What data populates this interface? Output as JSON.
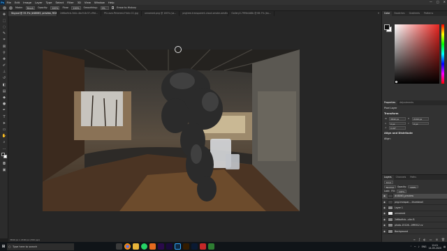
{
  "menubar": {
    "app_badge": "Ps",
    "items": [
      "File",
      "Edit",
      "Image",
      "Layer",
      "Type",
      "Select",
      "Filter",
      "3D",
      "View",
      "Window",
      "Help"
    ],
    "window_controls": [
      "—",
      "□",
      "✕"
    ]
  },
  "options": {
    "mode_label": "Mode:",
    "mode_value": "Brush",
    "opacity_label": "Opacity:",
    "opacity_value": "100%",
    "flow_label": "Flow:",
    "flow_value": "100%",
    "smoothing_label": "Smoothing:",
    "smoothing_value": "0%",
    "erase_history_label": "Erase to History"
  },
  "tabs": [
    {
      "label": "Sky.psd @ 33.3% (#48063, preview, RGB/8) *",
      "active": true
    },
    {
      "label": "2d6ba9cb-3d4c-4bc9-8c37-cf9d..."
    },
    {
      "label": "PS-Lava-Pinterest-Flickr-CC.jpg"
    },
    {
      "label": "unnamed.png @ 100% (La..."
    },
    {
      "label": "pngtree-transparent-cloud-smoke-aesthetic-monochrome-fire-thumbnail.png"
    },
    {
      "label": "Gallery2-7f99e4d8b @ 66.7% (ba..."
    }
  ],
  "status": {
    "text": "3840 px x 2160 px (300 ppi)"
  },
  "right": {
    "color_tabs": [
      "Color",
      "Swatches",
      "Gradients",
      "Patterns"
    ],
    "props_tabs": [
      "Properties",
      "Adjustments"
    ],
    "props_layer": "Pixel Layer",
    "transform_label": "Transform",
    "w_value": "3840 px",
    "h_value": "2160 px",
    "x_value": "0 px",
    "y_value": "0 px",
    "angle_value": "0.00°",
    "align_label": "Align and Distribute",
    "align_sub": "Align:",
    "layer_tabs": [
      "Layers",
      "Channels",
      "Paths"
    ],
    "kind_label": "Kind",
    "blend_value": "Normal",
    "opacity_label": "Opacity:",
    "opacity_value": "100%",
    "lock_label": "Lock:",
    "fill_label": "Fill:",
    "fill_value": "100%",
    "layers": [
      {
        "name": "#48063_preview",
        "selected": true,
        "thumb": "dark"
      },
      {
        "name": "png-transpar...-thumbnail",
        "thumb": "dark"
      },
      {
        "name": "Layer 1",
        "thumb": "grey"
      },
      {
        "name": "unnamed",
        "thumb": "white"
      },
      {
        "name": "2d6ba9cb...c4e-f1",
        "thumb": "grey"
      },
      {
        "name": "photo-15126...0ff9312 cv",
        "thumb": "grey"
      },
      {
        "name": "Background",
        "thumb": "grey"
      }
    ]
  },
  "taskbar": {
    "search_placeholder": "Type here to search",
    "time": "12:01",
    "date": "14-05-2020",
    "lang": "ENG"
  }
}
